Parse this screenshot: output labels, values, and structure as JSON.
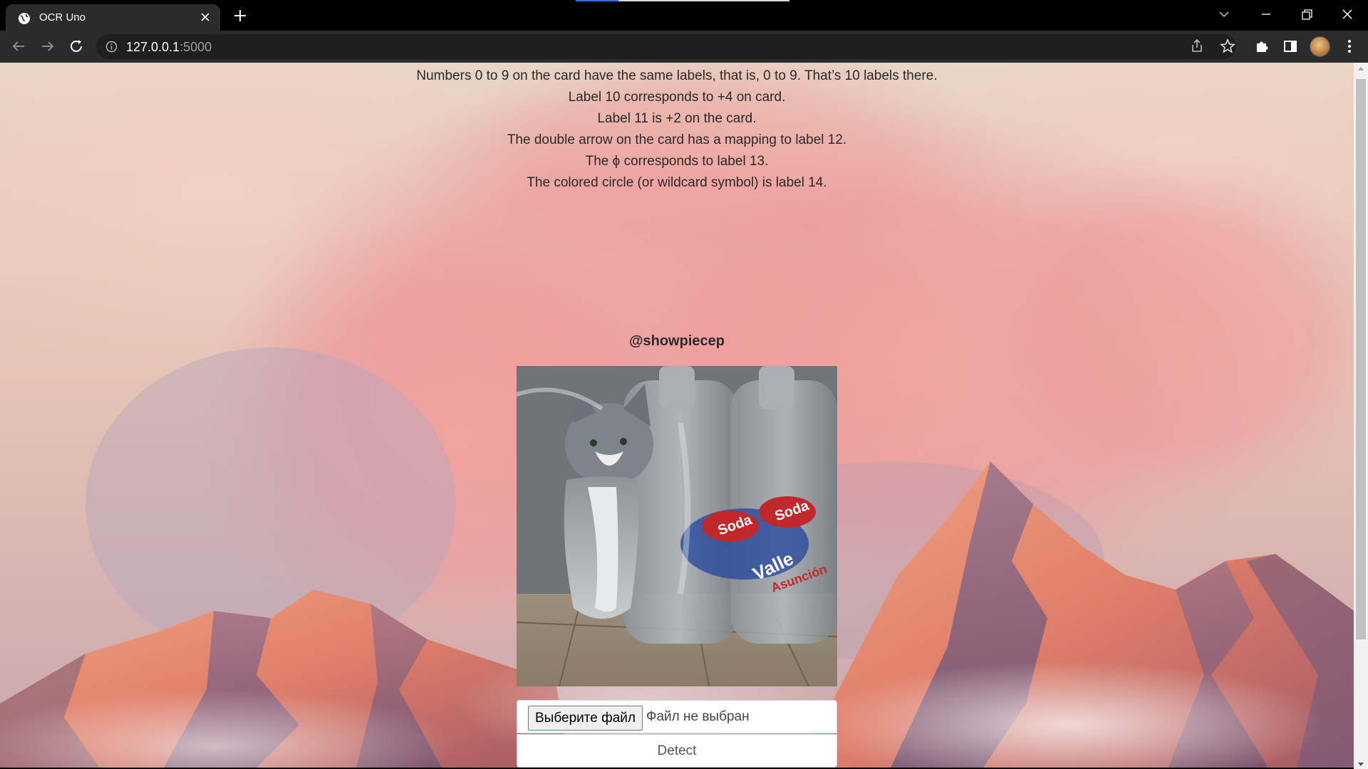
{
  "browser": {
    "tab_title": "OCR Uno",
    "url_host": "127.0.0.1",
    "url_port": ":5000",
    "icons": [
      "globe-icon",
      "close-icon",
      "plus-icon",
      "chevron-down-icon",
      "minimize-icon",
      "restore-icon",
      "window-close-icon",
      "back-arrow-icon",
      "forward-arrow-icon",
      "reload-icon",
      "info-icon",
      "share-icon",
      "star-icon",
      "puzzle-icon",
      "side-panel-icon",
      "kebab-menu-icon"
    ]
  },
  "page": {
    "instructions": [
      "Numbers 0 to 9 on the card have the same labels, that is, 0 to 9. That’s 10 labels there.",
      "Label 10 corresponds to +4 on card.",
      "Label 11 is +2 on the card.",
      "The double arrow on the card has a mapping to label 12.",
      "The ϕ corresponds to label 13.",
      "The colored circle (or wildcard symbol) is label 14."
    ],
    "author": "@showpiecep",
    "preview_image": {
      "bottle_text_1": "Soda",
      "bottle_text_2": "Soda",
      "bottle_text_3": "Valle",
      "bottle_text_4": "Asunción"
    },
    "file_input": {
      "button_label": "Выберите файл",
      "status": "Файл не выбран"
    },
    "detect_label": "Detect"
  }
}
